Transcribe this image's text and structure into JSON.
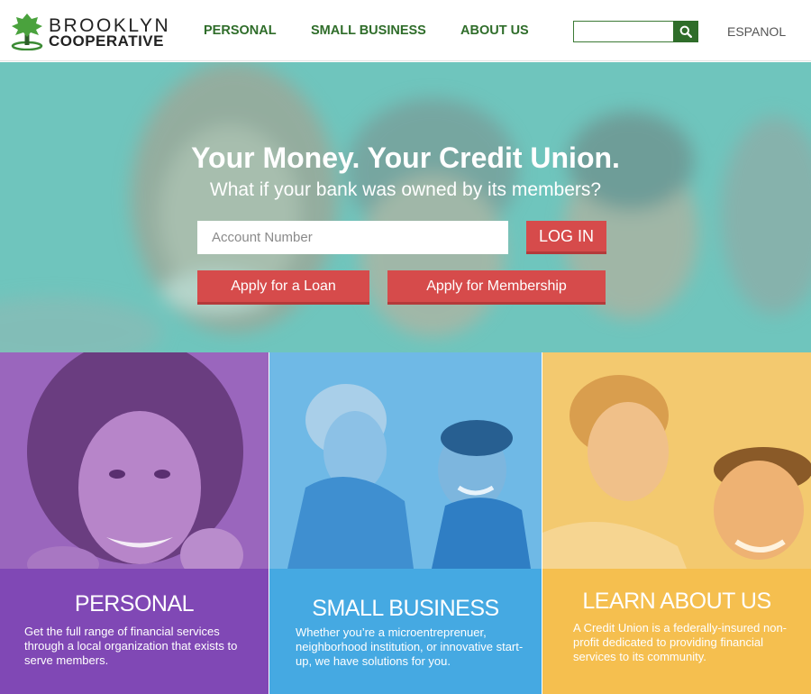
{
  "brand": {
    "line1": "BROOKLYN",
    "line2": "COOPERATIVE",
    "logo_icon": "tree-icon",
    "green": "#2f6d2a"
  },
  "nav": {
    "items": [
      {
        "label": "PERSONAL"
      },
      {
        "label": "SMALL BUSINESS"
      },
      {
        "label": "ABOUT US"
      }
    ],
    "search": {
      "value": "",
      "placeholder": "",
      "icon": "search-icon"
    },
    "language_link": "ESPANOL"
  },
  "hero": {
    "title": "Your Money. Your Credit Union.",
    "subtitle": "What if your bank was owned by its members?",
    "account_input": {
      "value": "",
      "placeholder": "Account Number"
    },
    "login_label": "LOG IN",
    "apply_loan_label": "Apply for a Loan",
    "apply_membership_label": "Apply for Membership",
    "background_color": "#6fc5bd",
    "button_color": "#d64b4b"
  },
  "panels": [
    {
      "heading": "PERSONAL",
      "text": "Get the full range of financial services through a local organization that exists to serve members.",
      "color": "#8048b5"
    },
    {
      "heading": "SMALL BUSINESS",
      "text": "Whether you’re a microentreprenuer, neighborhood institution, or innovative start-up, we have solutions for you.",
      "color": "#45a9e2"
    },
    {
      "heading": "LEARN ABOUT US",
      "text": "A Credit Union is a federally-insured non-profit dedicated to providing financial services to its community.",
      "color": "#f5bf4f"
    }
  ]
}
